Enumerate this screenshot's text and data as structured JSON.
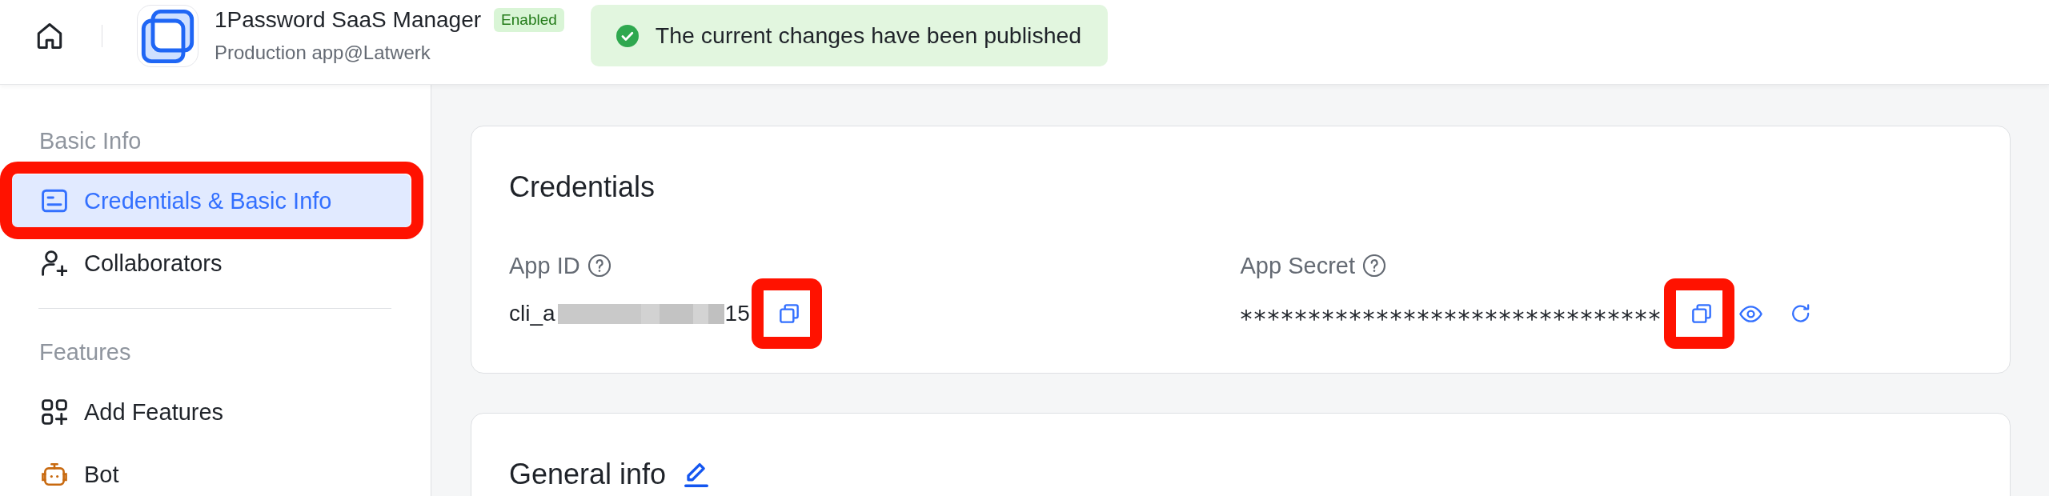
{
  "top_bar": {
    "app": {
      "name": "1Password SaaS Manager",
      "status": "Enabled",
      "subtitle": "Production app@Latwerk"
    },
    "toast": {
      "message": "The current changes have been published"
    }
  },
  "sidebar": {
    "sections": [
      {
        "label": "Basic Info",
        "items": [
          {
            "label": "Credentials & Basic Info",
            "selected": true,
            "highlighted": true
          },
          {
            "label": "Collaborators",
            "selected": false,
            "highlighted": false
          }
        ]
      },
      {
        "label": "Features",
        "items": [
          {
            "label": "Add Features",
            "selected": false,
            "highlighted": false
          },
          {
            "label": "Bot",
            "selected": false,
            "highlighted": false
          }
        ]
      }
    ]
  },
  "credentials": {
    "title": "Credentials",
    "fields": [
      {
        "label": "App ID",
        "value_parts": [
          "cli_a",
          "15"
        ],
        "actions": [
          {
            "kind": "copy",
            "highlighted": true
          }
        ]
      },
      {
        "label": "App Secret",
        "value_parts": [
          "*******************************"
        ],
        "actions": [
          {
            "kind": "copy",
            "highlighted": true
          },
          {
            "kind": "show",
            "highlighted": false
          },
          {
            "kind": "reset",
            "highlighted": false
          }
        ]
      }
    ]
  },
  "general_info": {
    "title": "General info"
  }
}
